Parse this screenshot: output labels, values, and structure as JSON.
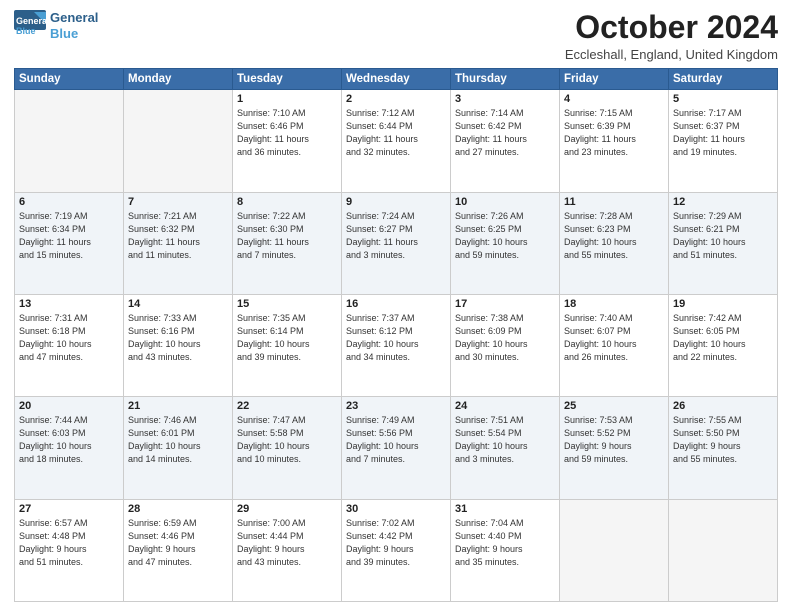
{
  "header": {
    "logo_line1": "General",
    "logo_line2": "Blue",
    "month_title": "October 2024",
    "location": "Eccleshall, England, United Kingdom"
  },
  "days_of_week": [
    "Sunday",
    "Monday",
    "Tuesday",
    "Wednesday",
    "Thursday",
    "Friday",
    "Saturday"
  ],
  "weeks": [
    [
      {
        "day": "",
        "info": ""
      },
      {
        "day": "",
        "info": ""
      },
      {
        "day": "1",
        "info": "Sunrise: 7:10 AM\nSunset: 6:46 PM\nDaylight: 11 hours\nand 36 minutes."
      },
      {
        "day": "2",
        "info": "Sunrise: 7:12 AM\nSunset: 6:44 PM\nDaylight: 11 hours\nand 32 minutes."
      },
      {
        "day": "3",
        "info": "Sunrise: 7:14 AM\nSunset: 6:42 PM\nDaylight: 11 hours\nand 27 minutes."
      },
      {
        "day": "4",
        "info": "Sunrise: 7:15 AM\nSunset: 6:39 PM\nDaylight: 11 hours\nand 23 minutes."
      },
      {
        "day": "5",
        "info": "Sunrise: 7:17 AM\nSunset: 6:37 PM\nDaylight: 11 hours\nand 19 minutes."
      }
    ],
    [
      {
        "day": "6",
        "info": "Sunrise: 7:19 AM\nSunset: 6:34 PM\nDaylight: 11 hours\nand 15 minutes."
      },
      {
        "day": "7",
        "info": "Sunrise: 7:21 AM\nSunset: 6:32 PM\nDaylight: 11 hours\nand 11 minutes."
      },
      {
        "day": "8",
        "info": "Sunrise: 7:22 AM\nSunset: 6:30 PM\nDaylight: 11 hours\nand 7 minutes."
      },
      {
        "day": "9",
        "info": "Sunrise: 7:24 AM\nSunset: 6:27 PM\nDaylight: 11 hours\nand 3 minutes."
      },
      {
        "day": "10",
        "info": "Sunrise: 7:26 AM\nSunset: 6:25 PM\nDaylight: 10 hours\nand 59 minutes."
      },
      {
        "day": "11",
        "info": "Sunrise: 7:28 AM\nSunset: 6:23 PM\nDaylight: 10 hours\nand 55 minutes."
      },
      {
        "day": "12",
        "info": "Sunrise: 7:29 AM\nSunset: 6:21 PM\nDaylight: 10 hours\nand 51 minutes."
      }
    ],
    [
      {
        "day": "13",
        "info": "Sunrise: 7:31 AM\nSunset: 6:18 PM\nDaylight: 10 hours\nand 47 minutes."
      },
      {
        "day": "14",
        "info": "Sunrise: 7:33 AM\nSunset: 6:16 PM\nDaylight: 10 hours\nand 43 minutes."
      },
      {
        "day": "15",
        "info": "Sunrise: 7:35 AM\nSunset: 6:14 PM\nDaylight: 10 hours\nand 39 minutes."
      },
      {
        "day": "16",
        "info": "Sunrise: 7:37 AM\nSunset: 6:12 PM\nDaylight: 10 hours\nand 34 minutes."
      },
      {
        "day": "17",
        "info": "Sunrise: 7:38 AM\nSunset: 6:09 PM\nDaylight: 10 hours\nand 30 minutes."
      },
      {
        "day": "18",
        "info": "Sunrise: 7:40 AM\nSunset: 6:07 PM\nDaylight: 10 hours\nand 26 minutes."
      },
      {
        "day": "19",
        "info": "Sunrise: 7:42 AM\nSunset: 6:05 PM\nDaylight: 10 hours\nand 22 minutes."
      }
    ],
    [
      {
        "day": "20",
        "info": "Sunrise: 7:44 AM\nSunset: 6:03 PM\nDaylight: 10 hours\nand 18 minutes."
      },
      {
        "day": "21",
        "info": "Sunrise: 7:46 AM\nSunset: 6:01 PM\nDaylight: 10 hours\nand 14 minutes."
      },
      {
        "day": "22",
        "info": "Sunrise: 7:47 AM\nSunset: 5:58 PM\nDaylight: 10 hours\nand 10 minutes."
      },
      {
        "day": "23",
        "info": "Sunrise: 7:49 AM\nSunset: 5:56 PM\nDaylight: 10 hours\nand 7 minutes."
      },
      {
        "day": "24",
        "info": "Sunrise: 7:51 AM\nSunset: 5:54 PM\nDaylight: 10 hours\nand 3 minutes."
      },
      {
        "day": "25",
        "info": "Sunrise: 7:53 AM\nSunset: 5:52 PM\nDaylight: 9 hours\nand 59 minutes."
      },
      {
        "day": "26",
        "info": "Sunrise: 7:55 AM\nSunset: 5:50 PM\nDaylight: 9 hours\nand 55 minutes."
      }
    ],
    [
      {
        "day": "27",
        "info": "Sunrise: 6:57 AM\nSunset: 4:48 PM\nDaylight: 9 hours\nand 51 minutes."
      },
      {
        "day": "28",
        "info": "Sunrise: 6:59 AM\nSunset: 4:46 PM\nDaylight: 9 hours\nand 47 minutes."
      },
      {
        "day": "29",
        "info": "Sunrise: 7:00 AM\nSunset: 4:44 PM\nDaylight: 9 hours\nand 43 minutes."
      },
      {
        "day": "30",
        "info": "Sunrise: 7:02 AM\nSunset: 4:42 PM\nDaylight: 9 hours\nand 39 minutes."
      },
      {
        "day": "31",
        "info": "Sunrise: 7:04 AM\nSunset: 4:40 PM\nDaylight: 9 hours\nand 35 minutes."
      },
      {
        "day": "",
        "info": ""
      },
      {
        "day": "",
        "info": ""
      }
    ]
  ]
}
